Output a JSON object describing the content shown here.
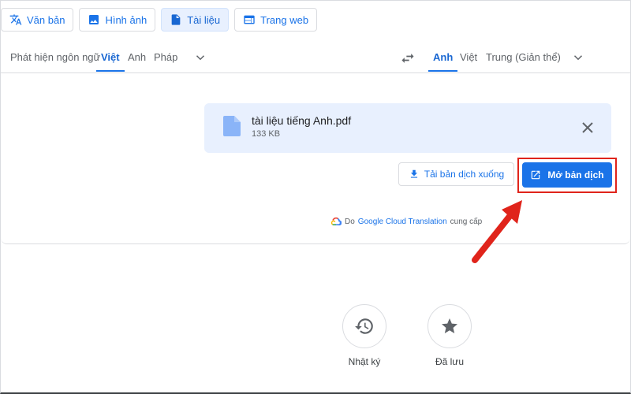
{
  "modes": [
    {
      "label": "Văn bản",
      "icon": "translate-icon",
      "active": false
    },
    {
      "label": "Hình ảnh",
      "icon": "image-icon",
      "active": false
    },
    {
      "label": "Tài liệu",
      "icon": "document-icon",
      "active": true
    },
    {
      "label": "Trang web",
      "icon": "web-icon",
      "active": false
    }
  ],
  "source_langs": [
    {
      "label": "Phát hiện ngôn ngữ",
      "active": false
    },
    {
      "label": "Việt",
      "active": true
    },
    {
      "label": "Anh",
      "active": false
    },
    {
      "label": "Pháp",
      "active": false
    }
  ],
  "target_langs": [
    {
      "label": "Anh",
      "active": true
    },
    {
      "label": "Việt",
      "active": false
    },
    {
      "label": "Trung (Giản thể)",
      "active": false
    }
  ],
  "file": {
    "name": "tài liệu tiếng Anh.pdf",
    "size": "133 KB"
  },
  "actions": {
    "download": "Tải bản dịch xuống",
    "open": "Mở bản dịch"
  },
  "credit": {
    "prefix": "Do",
    "brand": "Google Cloud Translation",
    "suffix": "cung cấp"
  },
  "bottom": {
    "history": "Nhật ký",
    "saved": "Đã lưu"
  },
  "colors": {
    "accent": "#1a73e8",
    "highlight": "#e0241b",
    "file_bg": "#e8f0fe"
  }
}
